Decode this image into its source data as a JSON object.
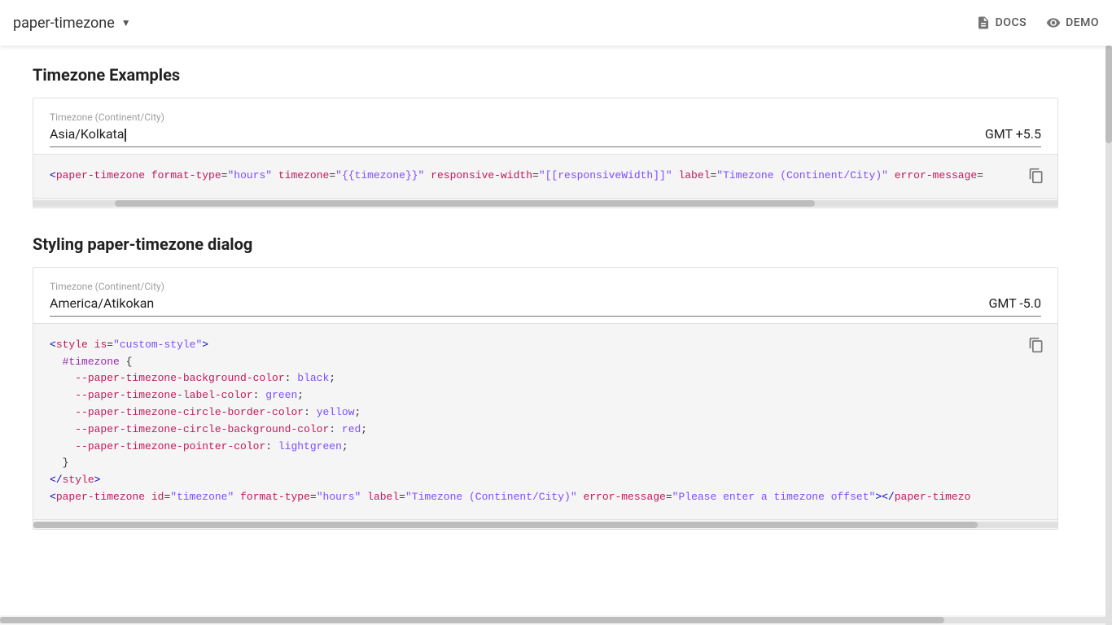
{
  "toolbar": {
    "title": "paper-timezone",
    "dropdown_arrow": "▼",
    "docs_label": "DOCS",
    "demo_label": "DEMO"
  },
  "sections": [
    {
      "id": "timezone-examples",
      "title": "Timezone Examples",
      "demo": {
        "label": "Timezone (Continent/City)",
        "value": "Asia/Kolkata",
        "gmt": "GMT +5.5"
      },
      "code_lines": [
        "<paper-timezone format-type=\"hours\" timezone=\"{{timezone}}\" responsive-width=\"[[responsiveWidth]]\" label=\"Timezone (Continent/City)\" error-message="
      ]
    },
    {
      "id": "styling-dialog",
      "title": "Styling paper-timezone dialog",
      "demo": {
        "label": "Timezone (Continent/City)",
        "value": "America/Atikokan",
        "gmt": "GMT -5.0"
      },
      "code_lines": [
        "<style is=\"custom-style\">",
        "  #timezone {",
        "    --paper-timezone-background-color: black;",
        "    --paper-timezone-label-color: green;",
        "    --paper-timezone-circle-border-color: yellow;",
        "    --paper-timezone-circle-background-color: red;",
        "    --paper-timezone-pointer-color: lightgreen;",
        "  }",
        "</style>",
        "<paper-timezone id=\"timezone\" format-type=\"hours\" label=\"Timezone (Continent/City)\" error-message=\"Please enter a timezone offset\"></paper-timezo"
      ]
    }
  ],
  "icons": {
    "docs": "📄",
    "demo": "👁",
    "copy": "⧉"
  }
}
